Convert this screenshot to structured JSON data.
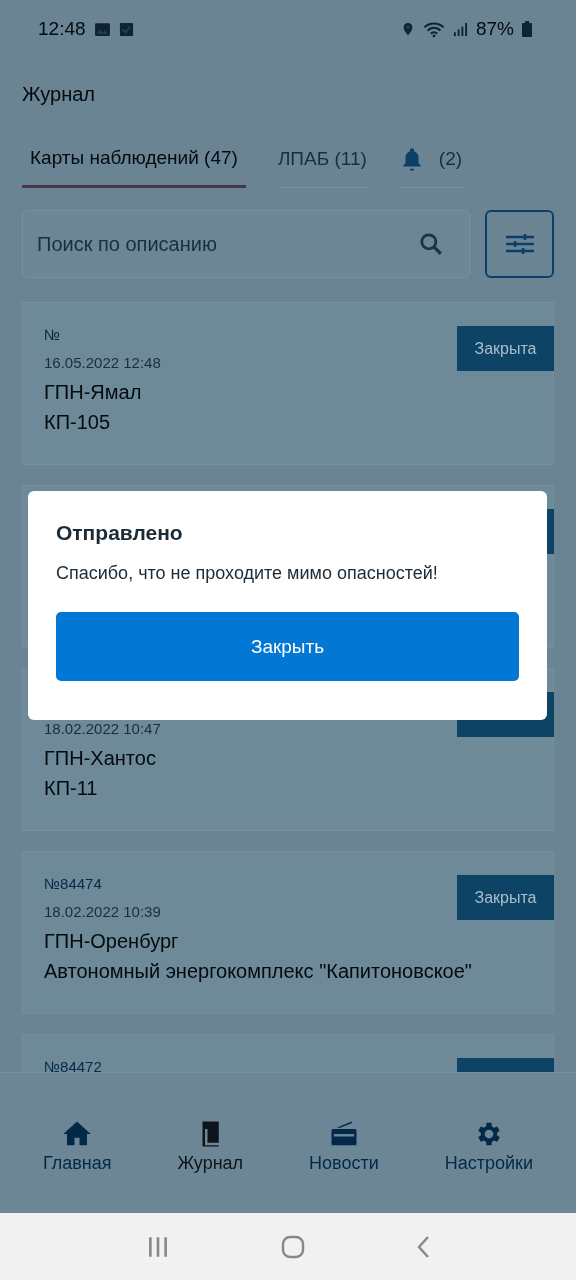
{
  "status_bar": {
    "time": "12:48",
    "battery": "87%"
  },
  "header": {
    "title": "Журнал"
  },
  "tabs": [
    {
      "kind": "text",
      "label": "Карты наблюдений (47)",
      "selected": true
    },
    {
      "kind": "text",
      "label": "ЛПАБ (11)",
      "selected": false
    },
    {
      "kind": "bell",
      "label": "(2)",
      "selected": false
    }
  ],
  "search": {
    "placeholder": "Поиск по описанию"
  },
  "records": [
    {
      "number": "№",
      "date": "16.05.2022 12:48",
      "company": "ГПН-Ямал",
      "site": "КП-105",
      "has_status": true,
      "status": "Закрыта"
    },
    {
      "has_status": true
    },
    {
      "date": "18.02.2022 10:47",
      "company": "ГПН-Хантос",
      "site": "КП-11",
      "has_status": true
    },
    {
      "number": "№84474",
      "date": "18.02.2022 10:39",
      "company": "ГПН-Оренбург",
      "site": "Автономный энергокомплекс \"Капитоновское\"",
      "has_status": true,
      "status": "Закрыта"
    },
    {
      "number": "№84472",
      "has_status": true
    }
  ],
  "dialog": {
    "title": "Отправлено",
    "message": "Спасибо, что не проходите мимо опасностей!",
    "button": "Закрыть"
  },
  "bottom_nav": [
    {
      "kind": "home",
      "label": "Главная",
      "selected": false
    },
    {
      "kind": "journal",
      "label": "Журнал",
      "selected": true
    },
    {
      "kind": "news",
      "label": "Новости",
      "selected": false
    },
    {
      "kind": "settings",
      "label": "Настройки",
      "selected": false
    }
  ]
}
